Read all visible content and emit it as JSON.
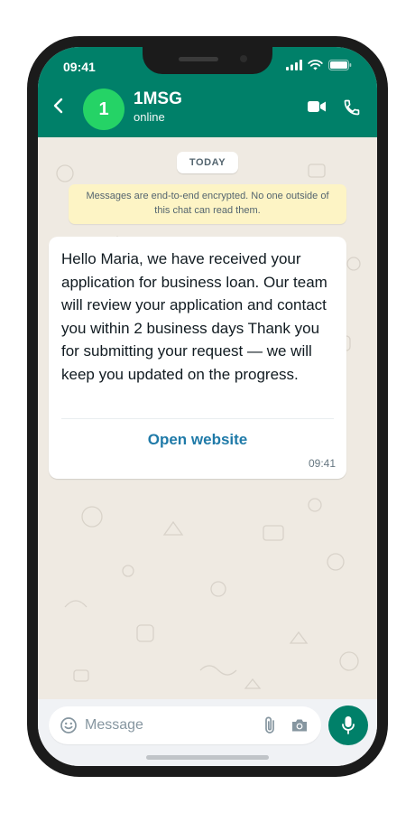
{
  "status_bar": {
    "time": "09:41"
  },
  "header": {
    "avatar_initial": "1",
    "title": "1MSG",
    "subtitle": "online",
    "icons": [
      "back-arrow-icon",
      "video-call-icon",
      "phone-call-icon"
    ]
  },
  "chat": {
    "date_label": "TODAY",
    "encryption_notice": "Messages are end-to-end encrypted. No one outside of this chat can read them.",
    "message": {
      "text": "Hello Maria, we have received your application for business loan. Our team will review your application and contact you within 2 business days Thank you for submitting your request — we will keep you updated on the progress.",
      "button_label": "Open website",
      "time": "09:41"
    }
  },
  "composer": {
    "placeholder": "Message",
    "icons": [
      "emoji-icon",
      "attach-icon",
      "camera-icon",
      "mic-icon"
    ]
  },
  "colors": {
    "header_green": "#008069",
    "avatar_green": "#25d366",
    "chat_background": "#efeae2",
    "encryption_yellow": "#fdf4c5",
    "link_blue": "#1f7aa8"
  }
}
